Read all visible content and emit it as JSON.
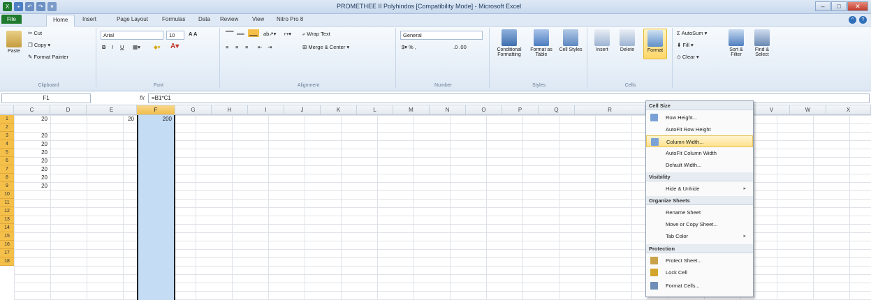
{
  "window": {
    "title": "PROMETHEE II Polyhindos [Compatibility Mode] - Microsoft Excel",
    "min": "–",
    "max": "□",
    "close": "✕"
  },
  "ribbon_tabs": [
    "File",
    "Home",
    "Insert",
    "Page Layout",
    "Formulas",
    "Data",
    "Review",
    "View",
    "Nitro Pro 8"
  ],
  "clipboard": {
    "paste": "Paste",
    "cut": "Cut",
    "copy": "Copy",
    "format_painter": "Format Painter",
    "label": "Clipboard"
  },
  "font": {
    "name": "Arial",
    "size": "10",
    "label": "Font"
  },
  "alignment": {
    "wrap": "Wrap Text",
    "merge": "Merge & Center",
    "label": "Alignment"
  },
  "number": {
    "format": "General",
    "label": "Number"
  },
  "styles": {
    "conditional": "Conditional Formatting",
    "format_table": "Format as Table",
    "cell_styles": "Cell Styles",
    "label": "Styles"
  },
  "cells": {
    "insert": "Insert",
    "delete": "Delete",
    "format": "Format",
    "label": "Cells"
  },
  "editing": {
    "autosum": "AutoSum",
    "fill": "Fill",
    "clear": "Clear",
    "sort": "Sort & Filter",
    "find": "Find & Select"
  },
  "formula_bar": {
    "namebox": "F1",
    "fx": "fx",
    "formula": "=B1*C1"
  },
  "columns": [
    "C",
    "D",
    "E",
    "F",
    "G",
    "H",
    "I",
    "J",
    "K",
    "L",
    "M",
    "N",
    "O",
    "P",
    "Q",
    "R",
    "V",
    "W",
    "X"
  ],
  "rows": [
    "1",
    "2",
    "3",
    "4",
    "5",
    "6",
    "7",
    "8",
    "9",
    "10",
    "11",
    "12",
    "13",
    "14",
    "15",
    "16",
    "17",
    "18"
  ],
  "cells_data": {
    "c1": "20",
    "e1": "20",
    "f1": "200",
    "c3": "20",
    "c4": "20",
    "c5": "20",
    "c6": "20",
    "c7": "20",
    "c8": "20",
    "c9": "20"
  },
  "format_menu": {
    "cell_size": "Cell Size",
    "row_height": "Row Height...",
    "autofit_row": "AutoFit Row Height",
    "column_width": "Column Width...",
    "autofit_col": "AutoFit Column Width",
    "default_width": "Default Width...",
    "visibility": "Visibility",
    "hide_unhide": "Hide & Unhide",
    "organize": "Organize Sheets",
    "rename": "Rename Sheet",
    "move_copy": "Move or Copy Sheet...",
    "tab_color": "Tab Color",
    "protection": "Protection",
    "protect_sheet": "Protect Sheet...",
    "lock_cell": "Lock Cell",
    "format_cells": "Format Cells..."
  },
  "colors": {
    "accent": "#1f7a2e",
    "selected_row_header": "#f5c04a",
    "selection": "#c5dcf5"
  }
}
